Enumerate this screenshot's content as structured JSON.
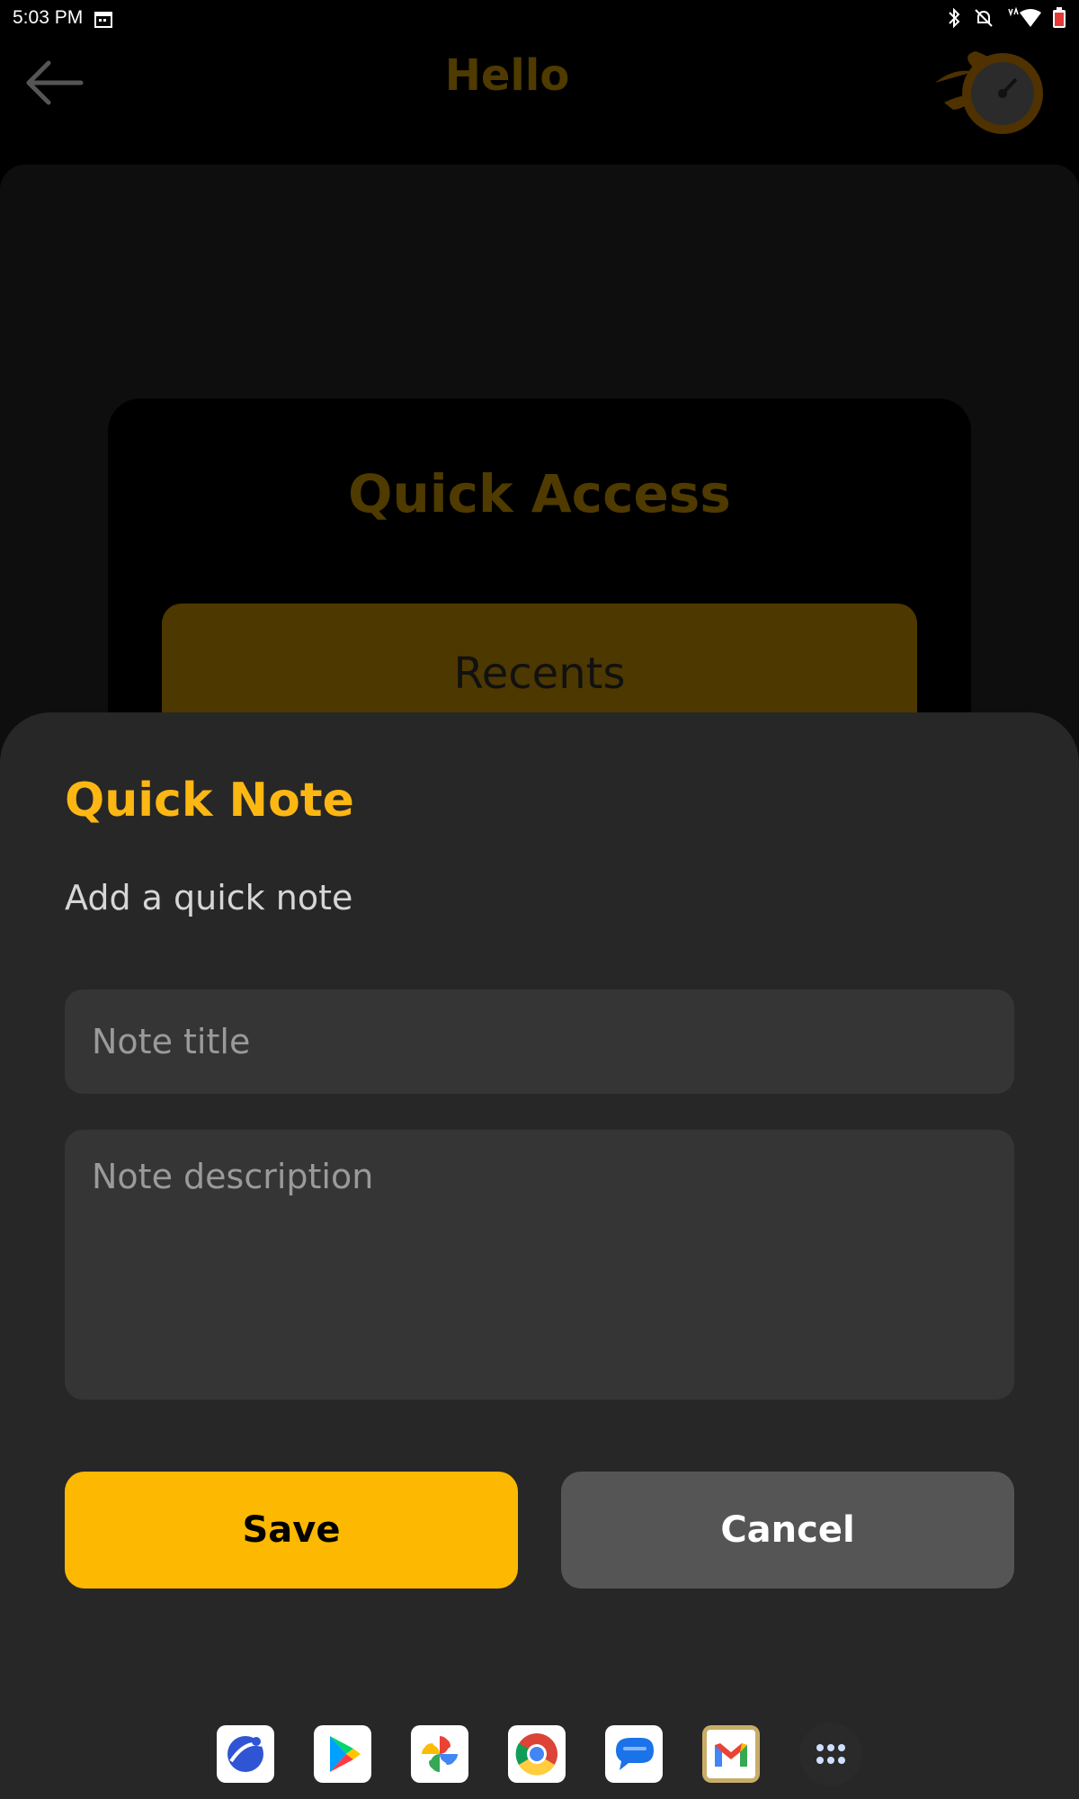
{
  "status_bar": {
    "time": "5:03 PM"
  },
  "header": {
    "title": "Hello"
  },
  "quick_access": {
    "title": "Quick Access",
    "recents_label": "Recents"
  },
  "quick_note": {
    "title": "Quick Note",
    "subtitle": "Add a quick note",
    "title_placeholder": "Note title",
    "description_placeholder": "Note description",
    "save_label": "Save",
    "cancel_label": "Cancel"
  },
  "dock": {
    "apps": [
      "app-browser-icon",
      "play-store-icon",
      "photos-icon",
      "chrome-icon",
      "messages-icon",
      "gmail-icon",
      "app-drawer-icon"
    ]
  },
  "colors": {
    "accent": "#fdb713",
    "sheet": "#272727",
    "field": "#353535",
    "cancel": "#555555"
  }
}
